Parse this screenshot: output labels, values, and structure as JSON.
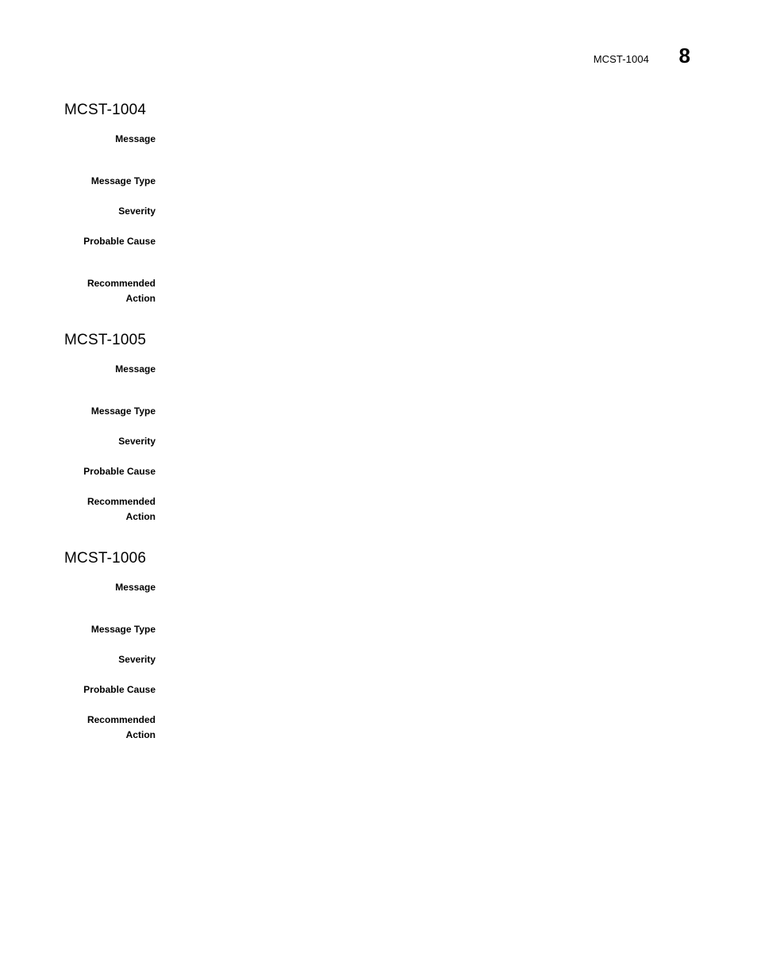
{
  "header": {
    "doc_id": "MCST-1004",
    "page_number": "8"
  },
  "labels": {
    "message": "Message",
    "message_type": "Message Type",
    "severity": "Severity",
    "probable_cause": "Probable Cause",
    "recommended_action": "Recommended\nAction"
  },
  "sections": [
    {
      "heading": "MCST-1004",
      "fields": {
        "message": "",
        "message_type": "",
        "severity": "",
        "probable_cause": "",
        "recommended_action": ""
      }
    },
    {
      "heading": "MCST-1005",
      "fields": {
        "message": "",
        "message_type": "",
        "severity": "",
        "probable_cause": "",
        "recommended_action": ""
      }
    },
    {
      "heading": "MCST-1006",
      "fields": {
        "message": "",
        "message_type": "",
        "severity": "",
        "probable_cause": "",
        "recommended_action": ""
      }
    }
  ]
}
